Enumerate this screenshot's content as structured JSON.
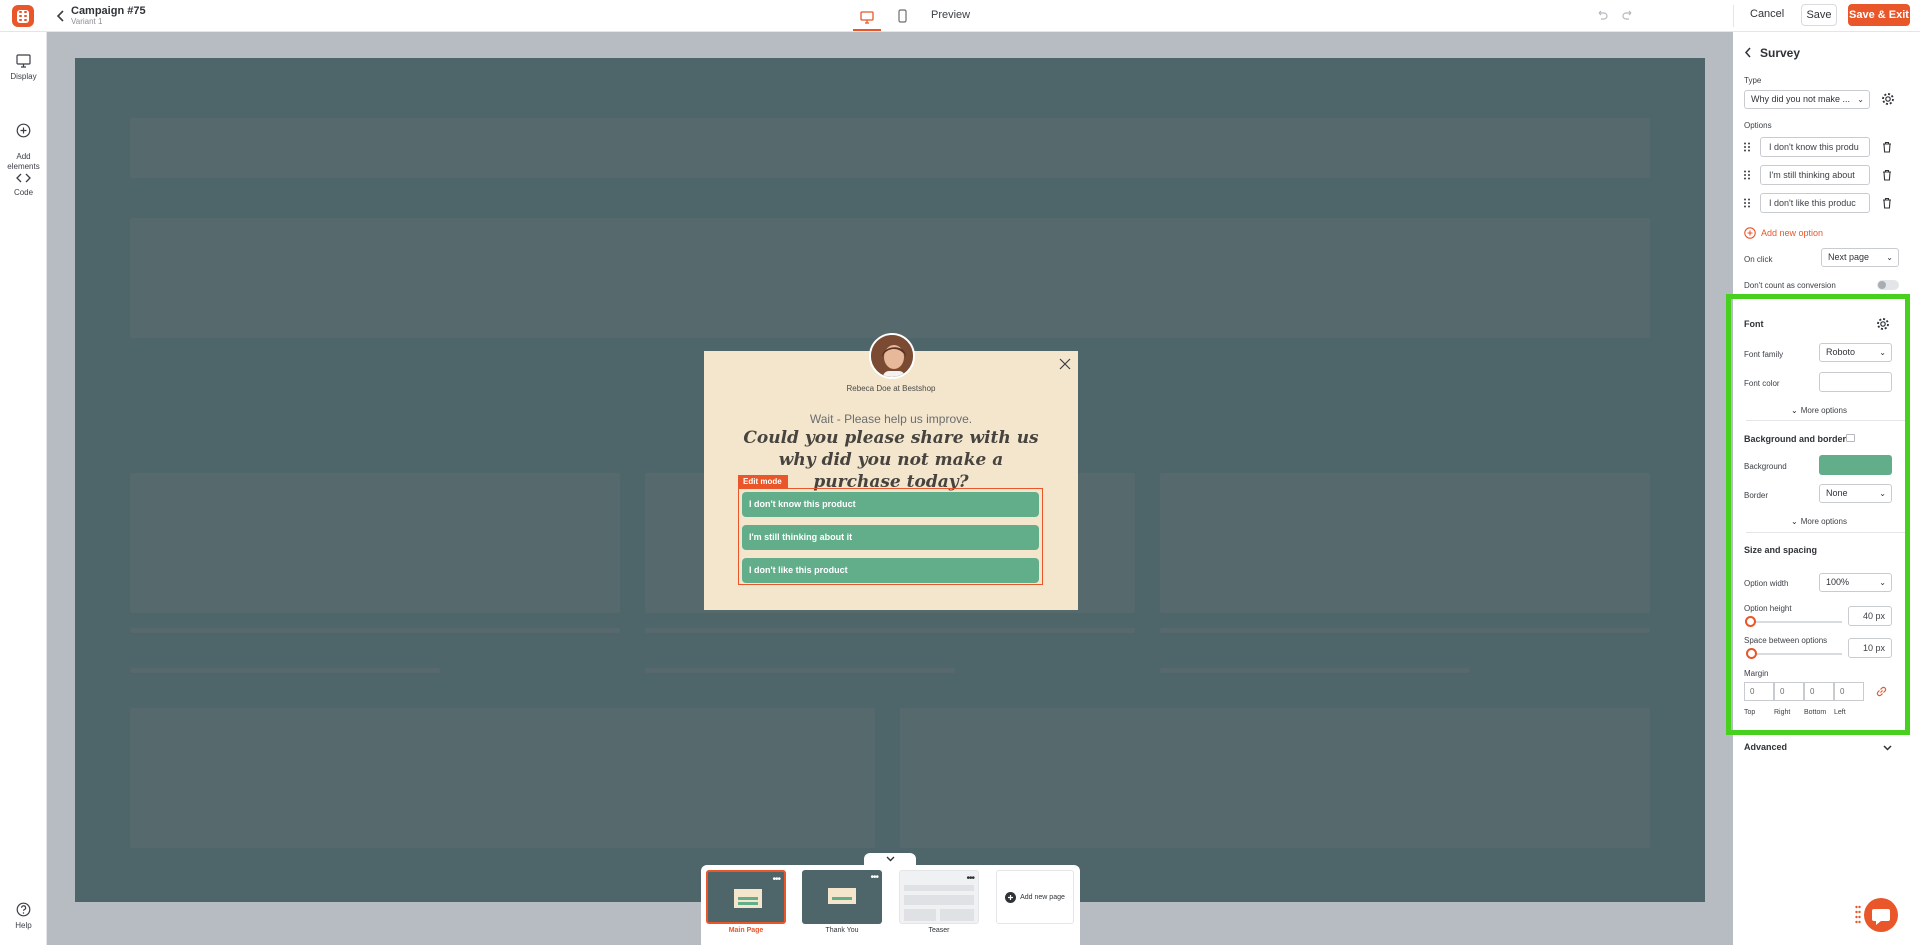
{
  "topbar": {
    "campaign_title": "Campaign #75",
    "variant": "Variant 1",
    "preview_label": "Preview",
    "cancel_label": "Cancel",
    "save_label": "Save",
    "save_exit_label": "Save & Exit"
  },
  "leftrail": {
    "items": [
      {
        "label": "Display",
        "icon": "monitor-icon"
      },
      {
        "label": "Add\nelements",
        "icon": "plus-circle-icon"
      },
      {
        "label": "Code",
        "icon": "code-icon"
      }
    ],
    "help_label": "Help"
  },
  "popup": {
    "sender": "Rebeca Doe at Bestshop",
    "subtitle": "Wait - Please help us improve.",
    "headline": "Could you please share with us why did you not make a purchase today?",
    "edit_mode_label": "Edit mode",
    "options": [
      "I don't know this product",
      "I'm still thinking about it",
      "I don't like this product"
    ]
  },
  "pages": {
    "items": [
      {
        "label": "Main Page",
        "active": true
      },
      {
        "label": "Thank You",
        "active": false
      },
      {
        "label": "Teaser",
        "active": false
      }
    ],
    "add_label": "Add new page"
  },
  "panel": {
    "title": "Survey",
    "type_label": "Type",
    "type_value": "Why did you not make ...",
    "options_label": "Options",
    "options": [
      "I don't know this produ",
      "I'm still thinking about",
      "I don't like this produc"
    ],
    "add_option_label": "Add new option",
    "on_click_label": "On click",
    "on_click_value": "Next page",
    "no_conversion_label": "Don't count as conversion",
    "font": {
      "title": "Font",
      "family_label": "Font family",
      "family_value": "Roboto",
      "color_label": "Font color",
      "more_label": "More options"
    },
    "background": {
      "title": "Background and border",
      "bg_label": "Background",
      "bg_color": "#62ae8b",
      "border_label": "Border",
      "border_value": "None",
      "more_label": "More options"
    },
    "size": {
      "title": "Size and spacing",
      "width_label": "Option width",
      "width_value": "100%",
      "height_label": "Option height",
      "height_value": "40",
      "space_label": "Space between options",
      "space_value": "10",
      "unit": "px",
      "margin_label": "Margin",
      "margin_values": [
        "0",
        "0",
        "0",
        "0"
      ],
      "margin_sides": [
        "Top",
        "Right",
        "Bottom",
        "Left"
      ]
    },
    "advanced_label": "Advanced"
  },
  "colors": {
    "accent": "#e8562a",
    "option_green": "#62ae8b",
    "popup_bg": "#f4e6cd",
    "stage_bg": "#4e6569",
    "highlight": "#47d11e"
  }
}
